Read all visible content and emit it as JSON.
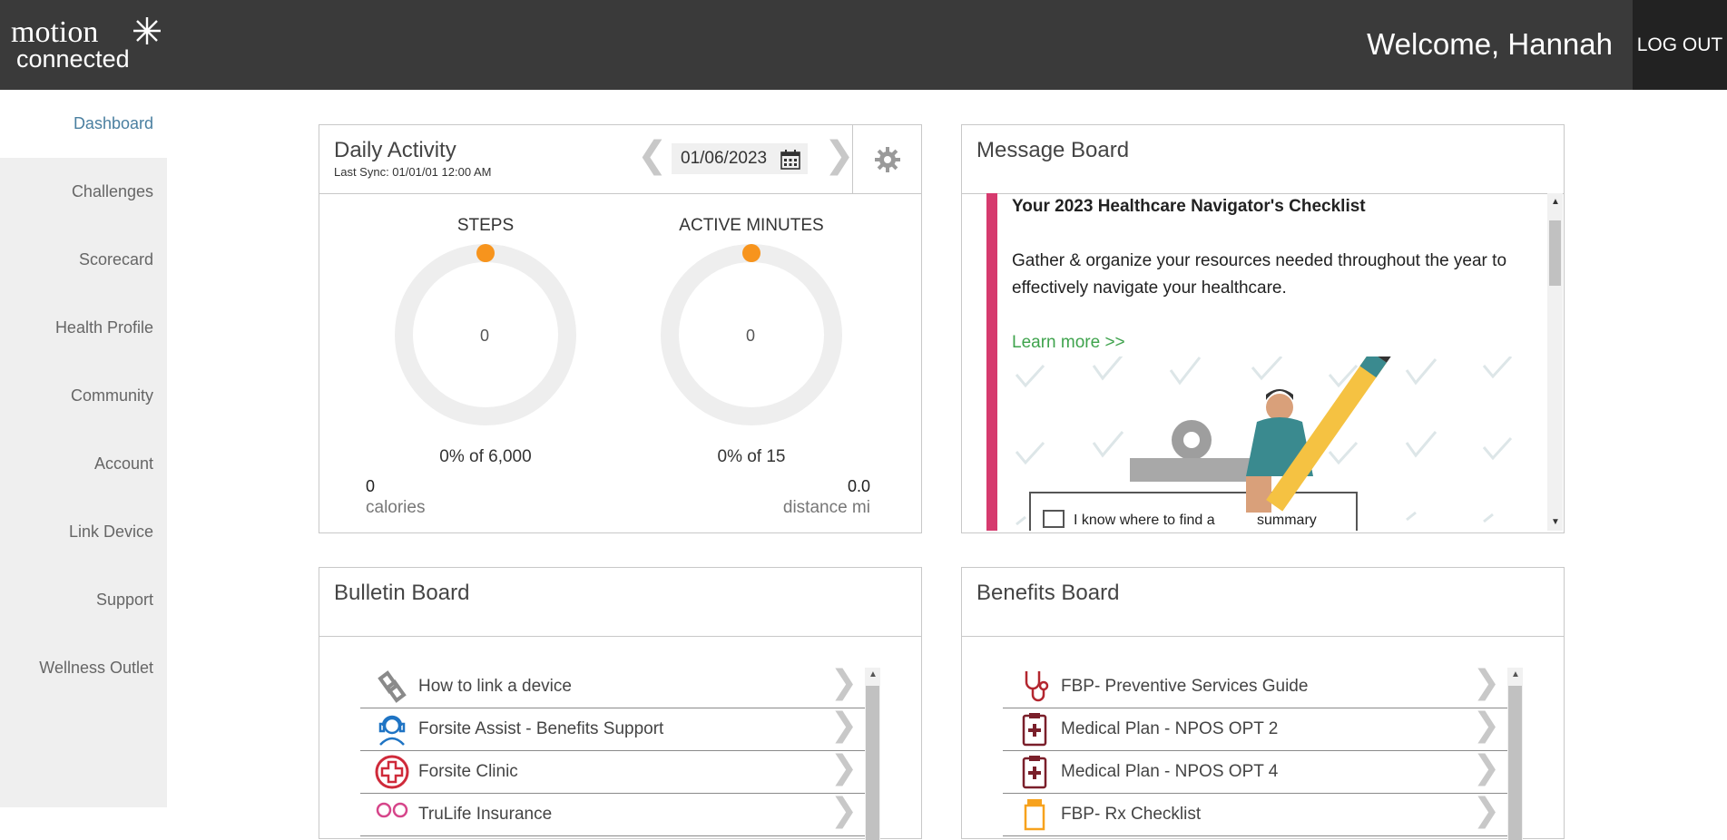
{
  "header": {
    "logo_line1": "motion",
    "logo_line2": "connected",
    "welcome": "Welcome, Hannah",
    "logout": "LOG OUT"
  },
  "sidebar": {
    "items": [
      {
        "label": "Dashboard",
        "active": true
      },
      {
        "label": "Challenges"
      },
      {
        "label": "Scorecard"
      },
      {
        "label": "Health Profile"
      },
      {
        "label": "Community"
      },
      {
        "label": "Account"
      },
      {
        "label": "Link Device"
      },
      {
        "label": "Support"
      },
      {
        "label": "Wellness Outlet"
      }
    ]
  },
  "daily_activity": {
    "title": "Daily Activity",
    "last_sync": "Last Sync: 01/01/01 12:00 AM",
    "date": "01/06/2023",
    "steps": {
      "label": "STEPS",
      "value": "0",
      "goal_text": "0% of 6,000",
      "progress": 0
    },
    "active_minutes": {
      "label": "ACTIVE MINUTES",
      "value": "0",
      "goal_text": "0% of 15",
      "progress": 0
    },
    "calories": {
      "value": "0",
      "label": "calories"
    },
    "distance": {
      "value": "0.0",
      "label": "distance mi"
    }
  },
  "message_board": {
    "title": "Message Board",
    "heading": "Your 2023 Healthcare Navigator's Checklist",
    "body": "Gather & organize your resources needed throughout the year to effectively navigate your healthcare.",
    "link": "Learn more >>",
    "illustration_text": "I know where to find a",
    "illustration_text2": "summary"
  },
  "bulletin_board": {
    "title": "Bulletin Board",
    "items": [
      {
        "label": "How to link a device",
        "icon": "link-icon"
      },
      {
        "label": "Forsite Assist - Benefits Support",
        "icon": "headset-icon"
      },
      {
        "label": "Forsite Clinic",
        "icon": "medical-cross-icon"
      },
      {
        "label": "TruLife Insurance",
        "icon": "glasses-icon"
      }
    ]
  },
  "benefits_board": {
    "title": "Benefits Board",
    "items": [
      {
        "label": "FBP- Preventive Services Guide",
        "icon": "stethoscope-icon"
      },
      {
        "label": "Medical Plan - NPOS OPT 2",
        "icon": "clipboard-medical-icon"
      },
      {
        "label": "Medical Plan - NPOS OPT 4",
        "icon": "clipboard-medical-icon"
      },
      {
        "label": "FBP- Rx Checklist",
        "icon": "pill-bottle-icon"
      }
    ]
  },
  "colors": {
    "header_bg": "#3a3a3a",
    "accent_orange": "#f7941d",
    "accent_pink": "#d63a6e",
    "link_green": "#3fa34d",
    "nav_active": "#4a7fa0"
  }
}
